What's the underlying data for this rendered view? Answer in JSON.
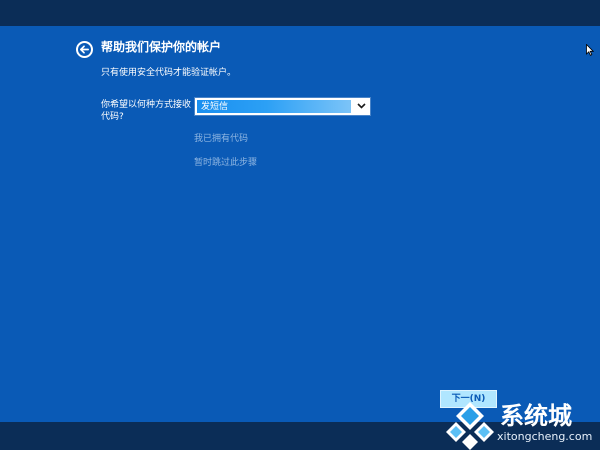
{
  "page": {
    "title": "帮助我们保护你的帐户",
    "subtitle": "只有使用安全代码才能验证帐户。"
  },
  "form": {
    "method_label": "你希望以何种方式接收代码?",
    "method_selected": "发短信"
  },
  "links": {
    "have_code": "我已拥有代码",
    "skip": "暂时跳过此步骤"
  },
  "buttons": {
    "next_label": "下一(N)"
  },
  "watermark": {
    "brand": "系统城",
    "url": "xitongcheng.com"
  },
  "icons": {
    "back": "back-arrow-icon",
    "dropdown": "chevron-down-icon",
    "cursor": "mouse-pointer-icon",
    "logo": "diamond-logo-icon"
  },
  "colors": {
    "background": "#0a5ab6",
    "band": "#0b2d57",
    "link": "#8fb6e2",
    "next_button": "#b0e6ff",
    "select_highlight": "#1a8ff0"
  }
}
